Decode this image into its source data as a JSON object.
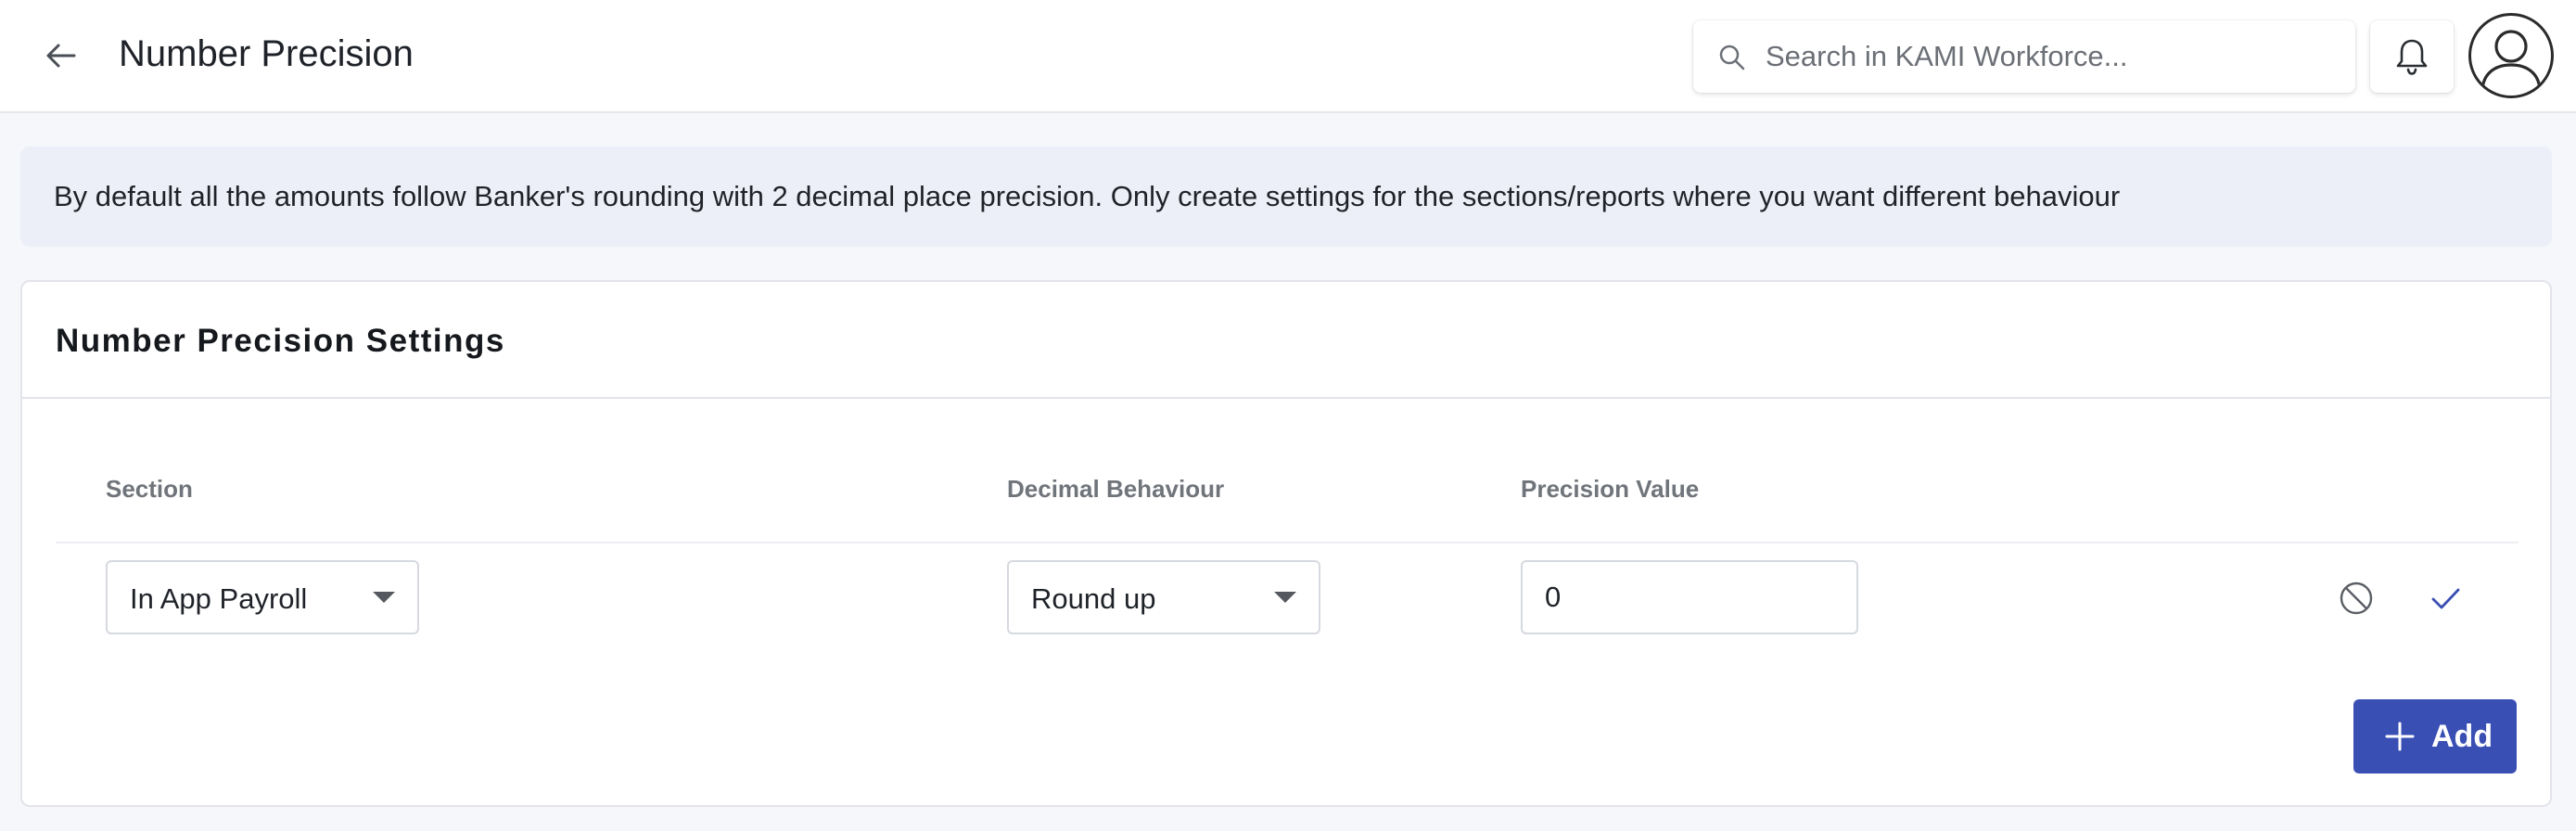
{
  "header": {
    "title": "Number Precision",
    "search_placeholder": "Search in KAMI Workforce..."
  },
  "banner": {
    "text": "By default all the amounts follow Banker's rounding with 2 decimal place precision. Only create settings for the sections/reports where you want different behaviour"
  },
  "settings": {
    "title": "Number Precision Settings",
    "columns": {
      "section": "Section",
      "decimal_behaviour": "Decimal Behaviour",
      "precision_value": "Precision Value"
    },
    "row": {
      "section_value": "In App Payroll",
      "decimal_behaviour_value": "Round up",
      "precision_value": "0"
    },
    "add_label": "Add"
  },
  "colors": {
    "primary": "#3a4fb4",
    "check": "#3a4fb4",
    "banner_bg": "#edeff8"
  }
}
